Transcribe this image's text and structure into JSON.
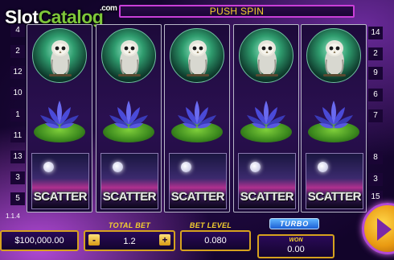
{
  "watermark": {
    "slot": "Slot",
    "catalog": "Catalog",
    "com": ".com"
  },
  "top_bar": {
    "message": "PUSH SPIN"
  },
  "paylines": {
    "left": [
      "4",
      "2",
      "12",
      "10",
      "1",
      "11",
      "13",
      "3",
      "5"
    ],
    "right": [
      "14",
      "2",
      "9",
      "6",
      "7",
      "8",
      "3",
      "15"
    ]
  },
  "reels": [
    {
      "top": "owl",
      "middle": "lotus",
      "bottom": "SCATTER"
    },
    {
      "top": "owl",
      "middle": "lotus",
      "bottom": "SCATTER"
    },
    {
      "top": "owl",
      "middle": "lotus",
      "bottom": "SCATTER"
    },
    {
      "top": "owl",
      "middle": "lotus",
      "bottom": "SCATTER"
    },
    {
      "top": "owl",
      "middle": "lotus",
      "bottom": "SCATTER"
    }
  ],
  "symbols": {
    "scatter_label": "SCATTER"
  },
  "version": "1.1.4",
  "panel": {
    "balance": "$100,000.00",
    "total_bet_label": "TOTAL BET",
    "total_bet_value": "1.2",
    "minus": "-",
    "plus": "+",
    "bet_level_label": "BET LEVEL",
    "bet_level_value": "0.080",
    "turbo_label": "TURBO",
    "win_label": "WON",
    "win_value": "0.00"
  },
  "colors": {
    "accent_gold": "#f6d12e",
    "frame_purple": "#c93fd8",
    "turbo_blue": "#1c5fd4"
  },
  "icons": {
    "spin": "play-arrow-icon"
  }
}
